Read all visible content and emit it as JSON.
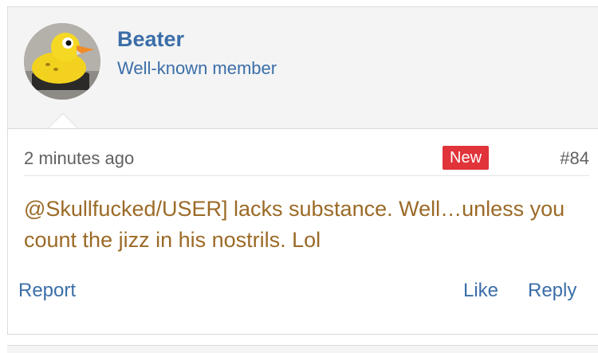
{
  "post": {
    "author": {
      "username": "Beater",
      "title": "Well-known member",
      "avatar_icon": "rubber-duck-avatar"
    },
    "meta": {
      "timestamp": "2 minutes ago",
      "badge": "New",
      "number": "#84"
    },
    "message": "@Skullfucked/USER] lacks substance. Well…unless you count the jizz in his nostrils. Lol",
    "actions": {
      "report": "Report",
      "like": "Like",
      "reply": "Reply"
    }
  },
  "colors": {
    "link": "#3b6ea8",
    "message_text": "#9b6a27",
    "badge_bg": "#e0333a",
    "header_bg": "#f4f4f4"
  }
}
